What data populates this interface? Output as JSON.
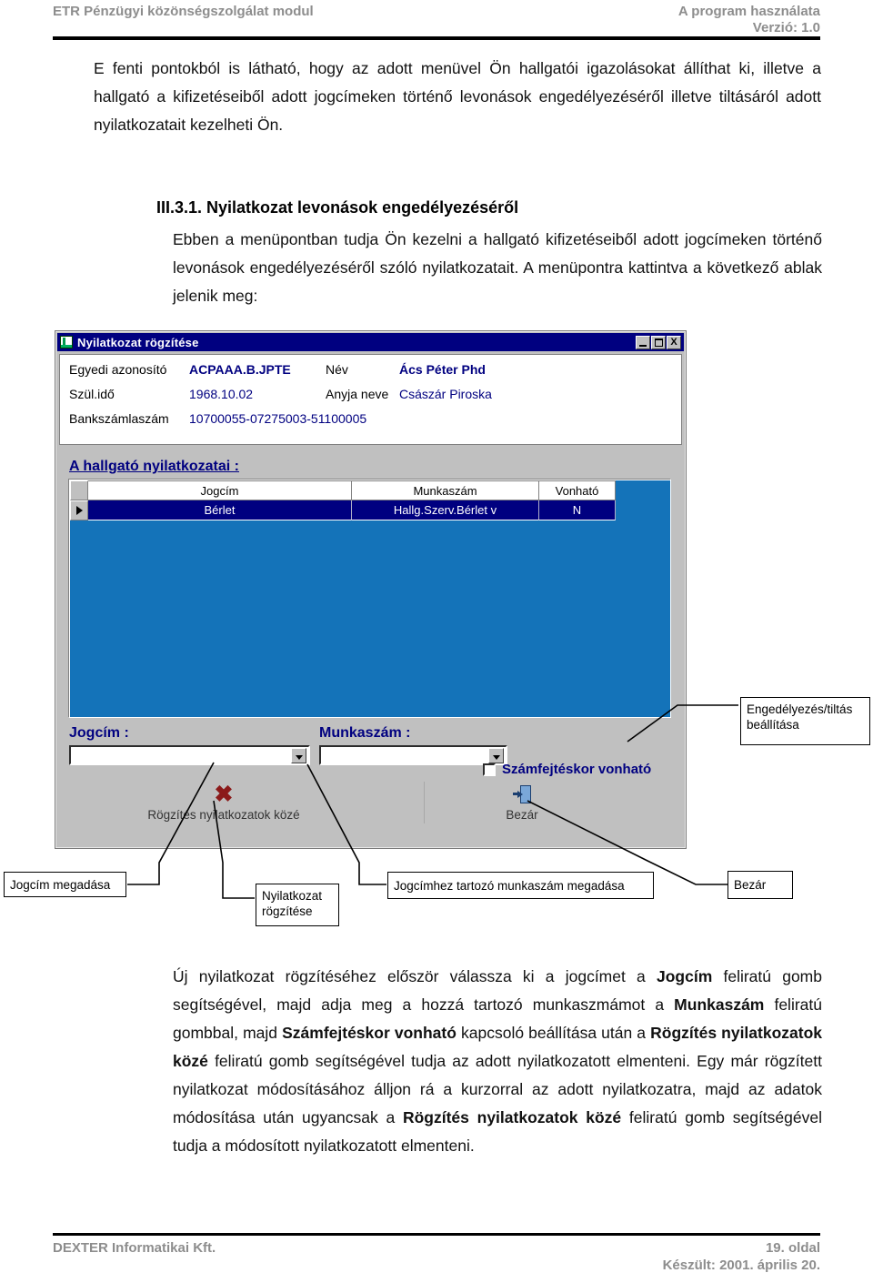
{
  "colors": {
    "header_gray": "#8d8d8d",
    "title_navy": "#000080",
    "grid_blue": "#1473b9",
    "dialog_face": "#c0c0c0",
    "label_navy": "#000080",
    "delete_red": "#8b1a1a"
  },
  "header": {
    "left": "ETR Pénzügyi közönségszolgálat modul",
    "right_line1": "A program használata",
    "right_line2": "Verzió: 1.0"
  },
  "intro_paragraph": "E fenti pontokból is látható, hogy az adott menüvel Ön hallgatói igazolásokat állíthat ki, illetve a hallgató a kifizetéseiből adott jogcímeken történő levonások engedélyezéséről illetve tiltásáról adott nyilatkozatait kezelheti Ön.",
  "section": {
    "heading": "III.3.1. Nyilatkozat levonások engedélyezéséről",
    "paragraph": "Ebben a menüpontban tudja Ön kezelni a hallgató kifizetéseiből adott jogcímeken történő levonások engedélyezéséről szóló nyilatkozatait. A menüpontra kattintva a következő ablak jelenik meg:"
  },
  "dialog": {
    "title": "Nyilatkozat rögzítése",
    "window_buttons": {
      "minimize": "minimize-icon",
      "maximize": "maximize-icon",
      "close": "X"
    },
    "student": {
      "fields": [
        {
          "label": "Egyedi azonosító",
          "value": "ACPAAA.B.JPTE",
          "bold": true
        },
        {
          "label": "Név",
          "value": "Ács Péter Phd",
          "bold": true
        },
        {
          "label": "Szül.idő",
          "value": "1968.10.02",
          "bold": false
        },
        {
          "label": "Anyja neve",
          "value": "Császár Piroska",
          "bold": false
        },
        {
          "label": "Bankszámlaszám",
          "value": "10700055-07275003-51100005",
          "bold": false
        }
      ]
    },
    "list": {
      "legend": "A hallgató nyilatkozatai :",
      "columns": [
        "Jogcím",
        "Munkaszám",
        "Vonható"
      ],
      "rows": [
        {
          "jogcim": "Bérlet",
          "munkaszam": "Hallg.Szerv.Bérlet v",
          "vonhato": "N",
          "selected": true
        }
      ]
    },
    "inputs": {
      "jogcim_label": "Jogcím :",
      "jogcim_value": "",
      "munkaszam_label": "Munkaszám :",
      "munkaszam_value": "",
      "checkbox_label": "Számfejtéskor vonható",
      "checkbox_checked": false
    },
    "toolbar": {
      "save_label": "Rögzítés nyilatkozatok közé",
      "close_label": "Bezár"
    }
  },
  "callouts": {
    "permission": "Engedélyezés/tiltás beállítása",
    "jogcim": "Jogcím megadása",
    "record": "Nyilatkozat rögzítése",
    "munkaszam": "Jogcímhez tartozó munkaszám  megadása",
    "close": "Bezár"
  },
  "closing_paragraph_1": "Új nyilatkozat rögzítéséhez először válassza ki a jogcímet a {b:Jogcím} feliratú gomb segítségével, majd adja meg a hozzá tartozó munkaszmámot a {b:Munkaszám} feliratú gombbal, majd {b:Számfejtéskor vonható} kapcsoló beállítása után a {b:Rögzítés nyilatkozatok közé} feliratú gomb segítségével tudja az adott nyilatkozatott elmenteni. Egy már rögzített nyilatkozat módosításához álljon rá a kurzorral az adott nyilatkozatra, majd az adatok módosítása után ugyancsak a {b:Rögzítés nyilatkozatok közé} feliratú gomb segítségével tudja a módosított nyilatkozatott elmenteni.",
  "footer": {
    "left": "DEXTER Informatikai Kft.",
    "right_line1": "19. oldal",
    "right_line2": "Készült: 2001. április 20."
  }
}
